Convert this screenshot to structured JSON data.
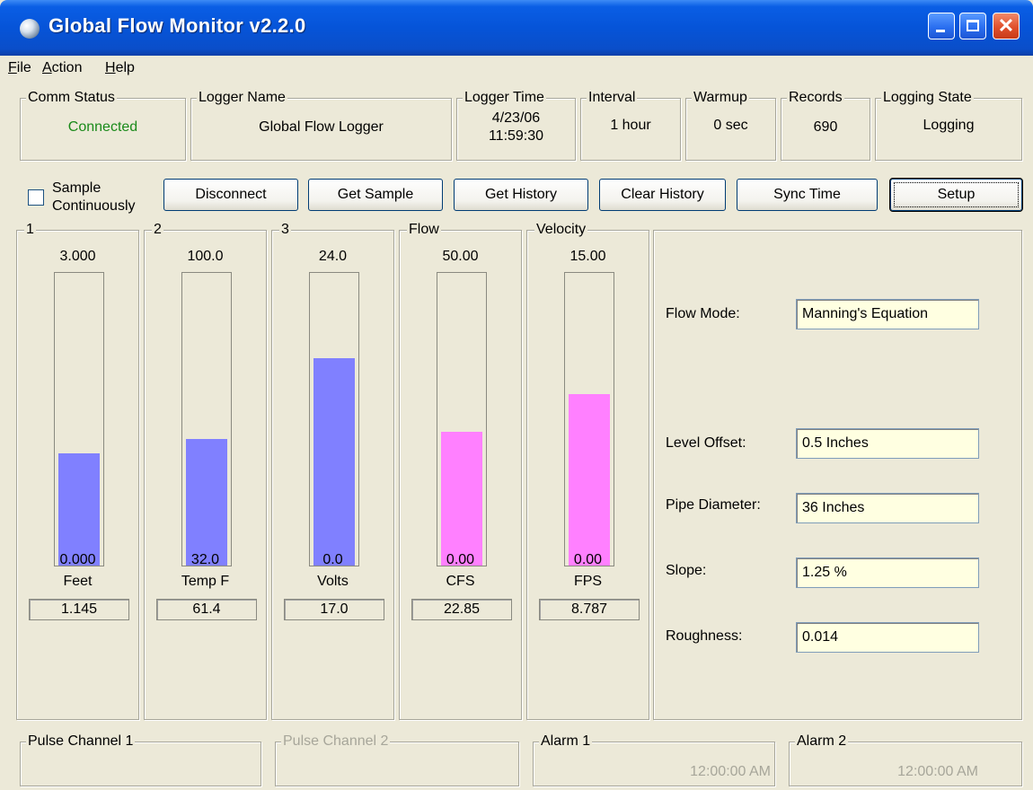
{
  "window": {
    "title": "Global Flow Monitor v2.2.0"
  },
  "menu": [
    {
      "key": "F",
      "rest": "ile"
    },
    {
      "key": "A",
      "rest": "ction"
    },
    {
      "key": "H",
      "rest": "elp"
    }
  ],
  "status": {
    "comm": {
      "label": "Comm Status",
      "value": "Connected",
      "color": "#1a8a1a"
    },
    "logger_name": {
      "label": "Logger Name",
      "value": "Global Flow Logger"
    },
    "logger_time": {
      "label": "Logger Time",
      "date": "4/23/06",
      "time": "11:59:30"
    },
    "interval": {
      "label": "Interval",
      "value": "1 hour"
    },
    "warmup": {
      "label": "Warmup",
      "value": "0 sec"
    },
    "records": {
      "label": "Records",
      "value": "690"
    },
    "logging_state": {
      "label": "Logging State",
      "value": "Logging"
    }
  },
  "controls": {
    "sample_continuously": {
      "line1": "Sample",
      "line2": "Continuously",
      "checked": false
    },
    "buttons": {
      "disconnect": "Disconnect",
      "get_sample": "Get Sample",
      "get_history": "Get History",
      "clear_history": "Clear History",
      "sync_time": "Sync Time",
      "setup": "Setup"
    }
  },
  "gauges": [
    {
      "label": "1",
      "max": "3.000",
      "min": "0.000",
      "unit": "Feet",
      "value": "1.145",
      "fill_fraction": 0.382,
      "color": "#8080ff"
    },
    {
      "label": "2",
      "max": "100.0",
      "min": "32.0",
      "unit": "Temp F",
      "value": "61.4",
      "fill_fraction": 0.432,
      "color": "#8080ff"
    },
    {
      "label": "3",
      "max": "24.0",
      "min": "0.0",
      "unit": "Volts",
      "value": "17.0",
      "fill_fraction": 0.708,
      "color": "#8080ff"
    },
    {
      "label": "Flow",
      "max": "50.00",
      "min": "0.00",
      "unit": "CFS",
      "value": "22.85",
      "fill_fraction": 0.457,
      "color": "#ff80ff"
    },
    {
      "label": "Velocity",
      "max": "15.00",
      "min": "0.00",
      "unit": "FPS",
      "value": "8.787",
      "fill_fraction": 0.586,
      "color": "#ff80ff"
    }
  ],
  "settings": {
    "flow_mode": {
      "label": "Flow Mode:",
      "value": "Manning's Equation"
    },
    "level_offset": {
      "label": "Level Offset:",
      "value": "0.5 Inches"
    },
    "pipe_diameter": {
      "label": "Pipe Diameter:",
      "value": "36 Inches"
    },
    "slope": {
      "label": "Slope:",
      "value": "1.25 %"
    },
    "roughness": {
      "label": "Roughness:",
      "value": "0.014"
    }
  },
  "bottom": {
    "pulse1": {
      "label": "Pulse Channel 1",
      "enabled": true
    },
    "pulse2": {
      "label": "Pulse Channel 2",
      "enabled": false
    },
    "alarm1": {
      "label": "Alarm 1",
      "time": "12:00:00 AM"
    },
    "alarm2": {
      "label": "Alarm 2",
      "time": "12:00:00 AM"
    }
  }
}
